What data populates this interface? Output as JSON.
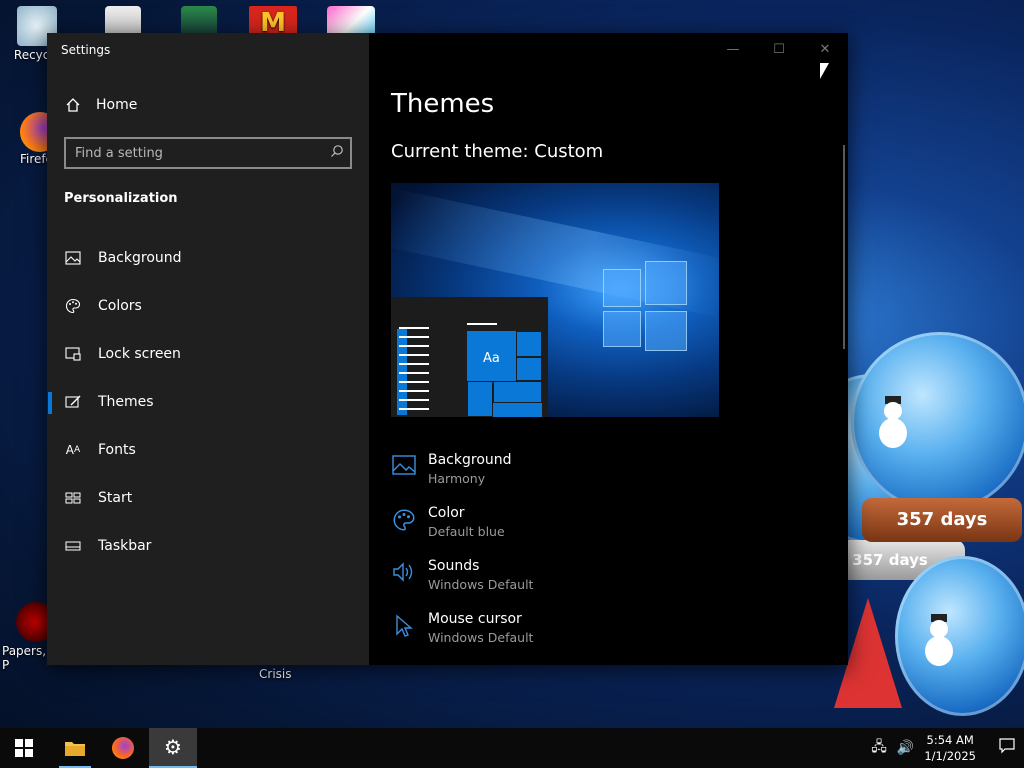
{
  "desktop": {
    "icons": [
      {
        "label": "Recycle"
      },
      {
        "label": "Firefo"
      },
      {
        "label": "Papers, P"
      }
    ],
    "extra_label": "Crisis"
  },
  "decorations": {
    "days_counter": "357 days",
    "days_counter_back": "357 days"
  },
  "window": {
    "title": "Settings",
    "controls": {
      "minimize": "—",
      "maximize": "☐",
      "close": "✕"
    }
  },
  "sidebar": {
    "home_label": "Home",
    "search_placeholder": "Find a setting",
    "section_title": "Personalization",
    "items": [
      {
        "label": "Background",
        "icon": "image-icon"
      },
      {
        "label": "Colors",
        "icon": "palette-icon"
      },
      {
        "label": "Lock screen",
        "icon": "lock-screen-icon"
      },
      {
        "label": "Themes",
        "icon": "themes-icon",
        "active": true
      },
      {
        "label": "Fonts",
        "icon": "fonts-icon"
      },
      {
        "label": "Start",
        "icon": "start-icon"
      },
      {
        "label": "Taskbar",
        "icon": "taskbar-icon"
      }
    ]
  },
  "main": {
    "heading": "Themes",
    "current_theme": "Current theme: Custom",
    "preview_sample": "Aa",
    "options": [
      {
        "title": "Background",
        "value": "Harmony",
        "icon": "image-icon"
      },
      {
        "title": "Color",
        "value": "Default blue",
        "icon": "palette-icon"
      },
      {
        "title": "Sounds",
        "value": "Windows Default",
        "icon": "speaker-icon"
      },
      {
        "title": "Mouse cursor",
        "value": "Windows Default",
        "icon": "cursor-icon"
      }
    ]
  },
  "taskbar": {
    "time": "5:54 AM",
    "date": "1/1/2025"
  },
  "colors": {
    "accent": "#0a78d7",
    "sidebar_bg": "#1f1f1f",
    "content_bg": "#000000"
  }
}
